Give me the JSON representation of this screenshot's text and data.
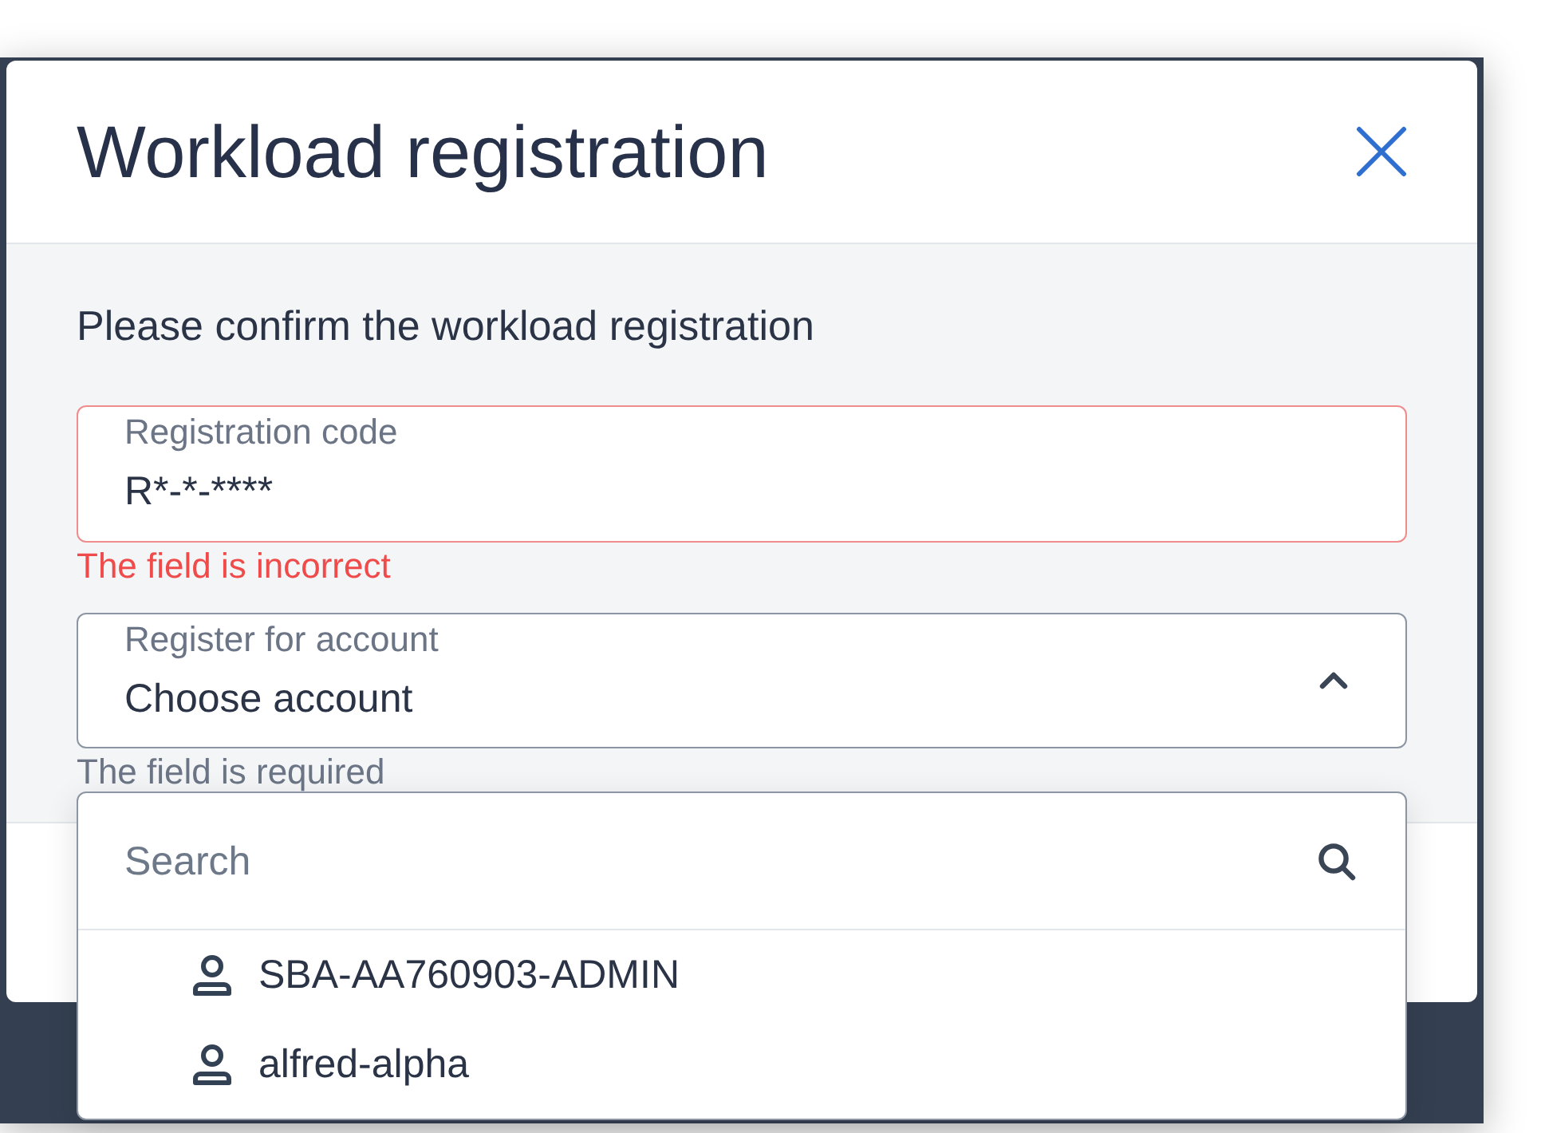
{
  "dialog": {
    "title": "Workload registration",
    "instruction": "Please confirm the workload registration"
  },
  "fields": [
    {
      "kind": "text",
      "label": "Registration code",
      "value": "R*-*-****",
      "invalid": true,
      "message": "The field is incorrect"
    },
    {
      "kind": "select",
      "label": "Register for account",
      "value": "Choose account",
      "invalid": false,
      "message": "The field is required",
      "expanded": true,
      "search": {
        "placeholder": "Search"
      },
      "options": [
        {
          "label": "SBA-AA760903-ADMIN"
        },
        {
          "label": "alfred-alpha"
        }
      ]
    }
  ]
}
